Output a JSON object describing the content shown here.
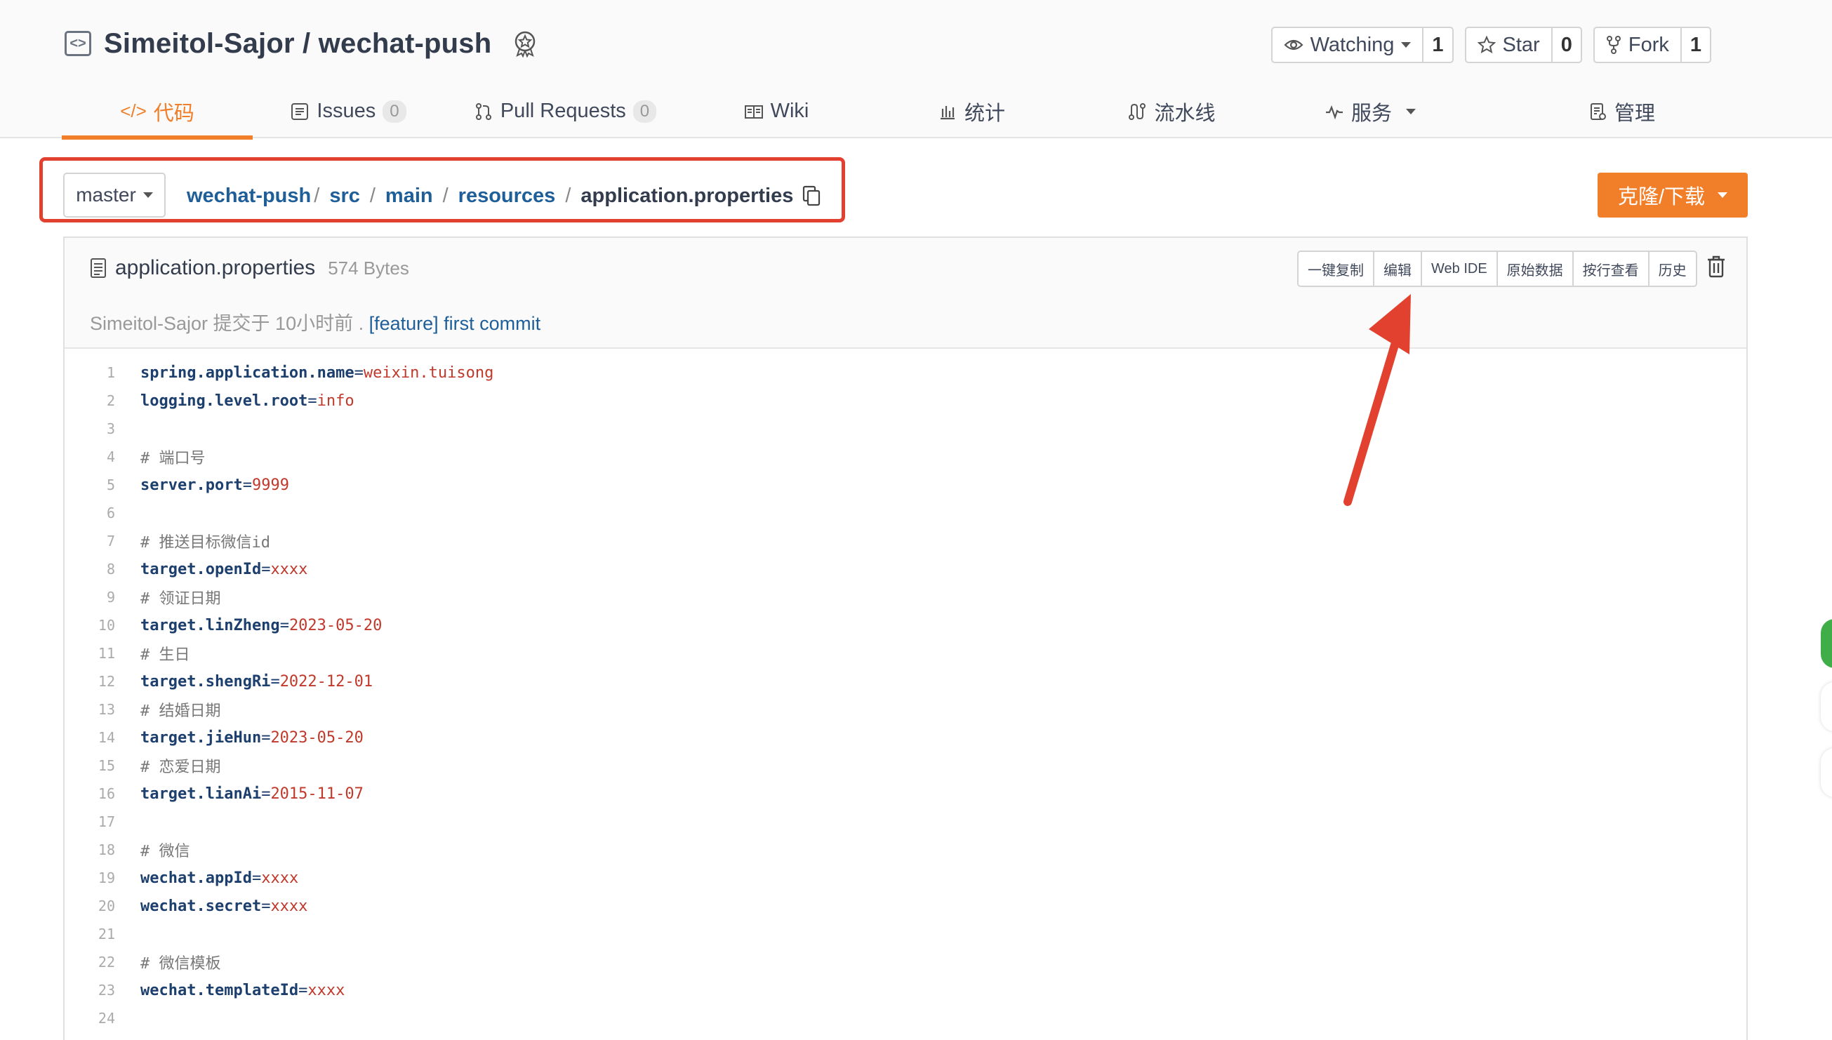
{
  "repo": {
    "owner_and_name": "Simeitol-Sajor / wechat-push",
    "watching_label": "Watching",
    "watching_count": "1",
    "star_label": "Star",
    "star_count": "0",
    "fork_label": "Fork",
    "fork_count": "1"
  },
  "tabs": [
    {
      "label": "代码",
      "icon": "code-icon"
    },
    {
      "label": "Issues",
      "count": "0",
      "icon": "issues-icon"
    },
    {
      "label": "Pull Requests",
      "count": "0",
      "icon": "pull-request-icon"
    },
    {
      "label": "Wiki",
      "icon": "wiki-icon"
    },
    {
      "label": "统计",
      "icon": "stats-icon"
    },
    {
      "label": "流水线",
      "icon": "pipeline-icon"
    },
    {
      "label": "服务",
      "icon": "service-icon"
    },
    {
      "label": "管理",
      "icon": "manage-icon"
    }
  ],
  "breadcrumb": {
    "branch": "master",
    "parts": [
      "wechat-push",
      "src",
      "main",
      "resources"
    ],
    "file": "application.properties"
  },
  "clone_button": "克隆/下载",
  "file": {
    "name": "application.properties",
    "size": "574 Bytes",
    "commit_author_text": "Simeitol-Sajor 提交于 10小时前 .",
    "commit_message": "[feature] first commit",
    "tools": [
      "一键复制",
      "编辑",
      "Web IDE",
      "原始数据",
      "按行查看",
      "历史"
    ]
  },
  "code_lines": [
    {
      "n": "1",
      "key": "spring.application.name",
      "val": "weixin.tuisong"
    },
    {
      "n": "2",
      "key": "logging.level.root",
      "val": "info"
    },
    {
      "n": "3"
    },
    {
      "n": "4",
      "comment": "# 端口号"
    },
    {
      "n": "5",
      "key": "server.port",
      "val": "9999"
    },
    {
      "n": "6"
    },
    {
      "n": "7",
      "comment": "# 推送目标微信id"
    },
    {
      "n": "8",
      "key": "target.openId",
      "val": "xxxx"
    },
    {
      "n": "9",
      "comment": "# 领证日期"
    },
    {
      "n": "10",
      "key": "target.linZheng",
      "val": "2023-05-20"
    },
    {
      "n": "11",
      "comment": "# 生日"
    },
    {
      "n": "12",
      "key": "target.shengRi",
      "val": "2022-12-01"
    },
    {
      "n": "13",
      "comment": "# 结婚日期"
    },
    {
      "n": "14",
      "key": "target.jieHun",
      "val": "2023-05-20"
    },
    {
      "n": "15",
      "comment": "# 恋爱日期"
    },
    {
      "n": "16",
      "key": "target.lianAi",
      "val": "2015-11-07"
    },
    {
      "n": "17"
    },
    {
      "n": "18",
      "comment": "# 微信"
    },
    {
      "n": "19",
      "key": "wechat.appId",
      "val": "xxxx"
    },
    {
      "n": "20",
      "key": "wechat.secret",
      "val": "xxxx"
    },
    {
      "n": "21"
    },
    {
      "n": "22",
      "comment": "# 微信模板"
    },
    {
      "n": "23",
      "key": "wechat.templateId",
      "val": "xxxx"
    },
    {
      "n": "24"
    }
  ],
  "colors": {
    "accent": "#f17e29",
    "link": "#1f5f99",
    "highlight_box": "#e3412f"
  }
}
